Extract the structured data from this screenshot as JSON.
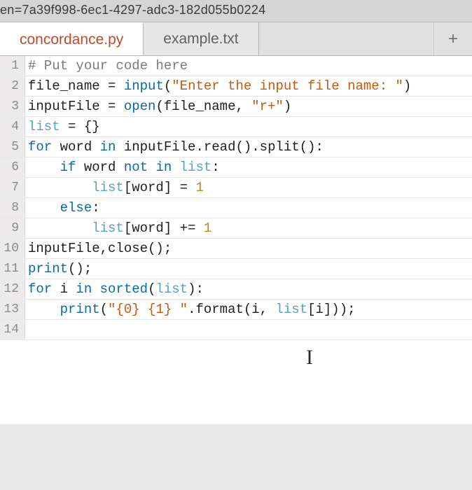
{
  "url_fragment": "en=7a39f998-6ec1-4297-adc3-182d055b0224",
  "tabs": {
    "items": [
      {
        "label": "concordance.py",
        "active": true
      },
      {
        "label": "example.txt",
        "active": false
      }
    ],
    "add_label": "+"
  },
  "code_lines": [
    {
      "n": "1",
      "tokens": [
        {
          "t": "# Put your code here",
          "c": "t-comment"
        }
      ]
    },
    {
      "n": "2",
      "tokens": [
        {
          "t": "file_name ",
          "c": "t-var"
        },
        {
          "t": "= ",
          "c": "t-var"
        },
        {
          "t": "input",
          "c": "t-builtin"
        },
        {
          "t": "(",
          "c": "t-var"
        },
        {
          "t": "\"Enter the input file name: \"",
          "c": "t-string"
        },
        {
          "t": ")",
          "c": "t-var"
        }
      ]
    },
    {
      "n": "3",
      "tokens": [
        {
          "t": "inputFile ",
          "c": "t-var"
        },
        {
          "t": "= ",
          "c": "t-var"
        },
        {
          "t": "open",
          "c": "t-builtin"
        },
        {
          "t": "(file_name, ",
          "c": "t-var"
        },
        {
          "t": "\"r+\"",
          "c": "t-string"
        },
        {
          "t": ")",
          "c": "t-var"
        }
      ]
    },
    {
      "n": "4",
      "tokens": [
        {
          "t": "list",
          "c": "t-warn"
        },
        {
          "t": " = {}",
          "c": "t-var"
        }
      ]
    },
    {
      "n": "5",
      "tokens": [
        {
          "t": "for ",
          "c": "t-keyword"
        },
        {
          "t": "word ",
          "c": "t-var"
        },
        {
          "t": "in ",
          "c": "t-keyword"
        },
        {
          "t": "inputFile.read().split():",
          "c": "t-var"
        }
      ]
    },
    {
      "n": "6",
      "tokens": [
        {
          "t": "    ",
          "c": "t-var"
        },
        {
          "t": "if ",
          "c": "t-keyword"
        },
        {
          "t": "word ",
          "c": "t-var"
        },
        {
          "t": "not in ",
          "c": "t-keyword"
        },
        {
          "t": "list",
          "c": "t-warn"
        },
        {
          "t": ":",
          "c": "t-var"
        }
      ]
    },
    {
      "n": "7",
      "tokens": [
        {
          "t": "        ",
          "c": "t-var"
        },
        {
          "t": "list",
          "c": "t-warn"
        },
        {
          "t": "[word] = ",
          "c": "t-var"
        },
        {
          "t": "1",
          "c": "t-number"
        }
      ]
    },
    {
      "n": "8",
      "tokens": [
        {
          "t": "    ",
          "c": "t-var"
        },
        {
          "t": "else",
          "c": "t-keyword"
        },
        {
          "t": ":",
          "c": "t-var"
        }
      ]
    },
    {
      "n": "9",
      "tokens": [
        {
          "t": "        ",
          "c": "t-var"
        },
        {
          "t": "list",
          "c": "t-warn"
        },
        {
          "t": "[word] += ",
          "c": "t-var"
        },
        {
          "t": "1",
          "c": "t-number"
        }
      ]
    },
    {
      "n": "10",
      "tokens": [
        {
          "t": "inputFile,close();",
          "c": "t-var"
        }
      ]
    },
    {
      "n": "11",
      "tokens": [
        {
          "t": "print",
          "c": "t-builtin"
        },
        {
          "t": "();",
          "c": "t-var"
        }
      ]
    },
    {
      "n": "12",
      "tokens": [
        {
          "t": "for ",
          "c": "t-keyword"
        },
        {
          "t": "i ",
          "c": "t-var"
        },
        {
          "t": "in ",
          "c": "t-keyword"
        },
        {
          "t": "sorted",
          "c": "t-builtin"
        },
        {
          "t": "(",
          "c": "t-var"
        },
        {
          "t": "list",
          "c": "t-warn"
        },
        {
          "t": "):",
          "c": "t-var"
        }
      ]
    },
    {
      "n": "13",
      "tokens": [
        {
          "t": "    ",
          "c": "t-var"
        },
        {
          "t": "print",
          "c": "t-builtin"
        },
        {
          "t": "(",
          "c": "t-var"
        },
        {
          "t": "\"{0} {1} \"",
          "c": "t-string"
        },
        {
          "t": ".format(i, ",
          "c": "t-var"
        },
        {
          "t": "list",
          "c": "t-warn"
        },
        {
          "t": "[i]));",
          "c": "t-var"
        }
      ]
    },
    {
      "n": "14",
      "tokens": [
        {
          "t": "",
          "c": "t-var"
        }
      ]
    }
  ],
  "cursor_glyph": "I"
}
